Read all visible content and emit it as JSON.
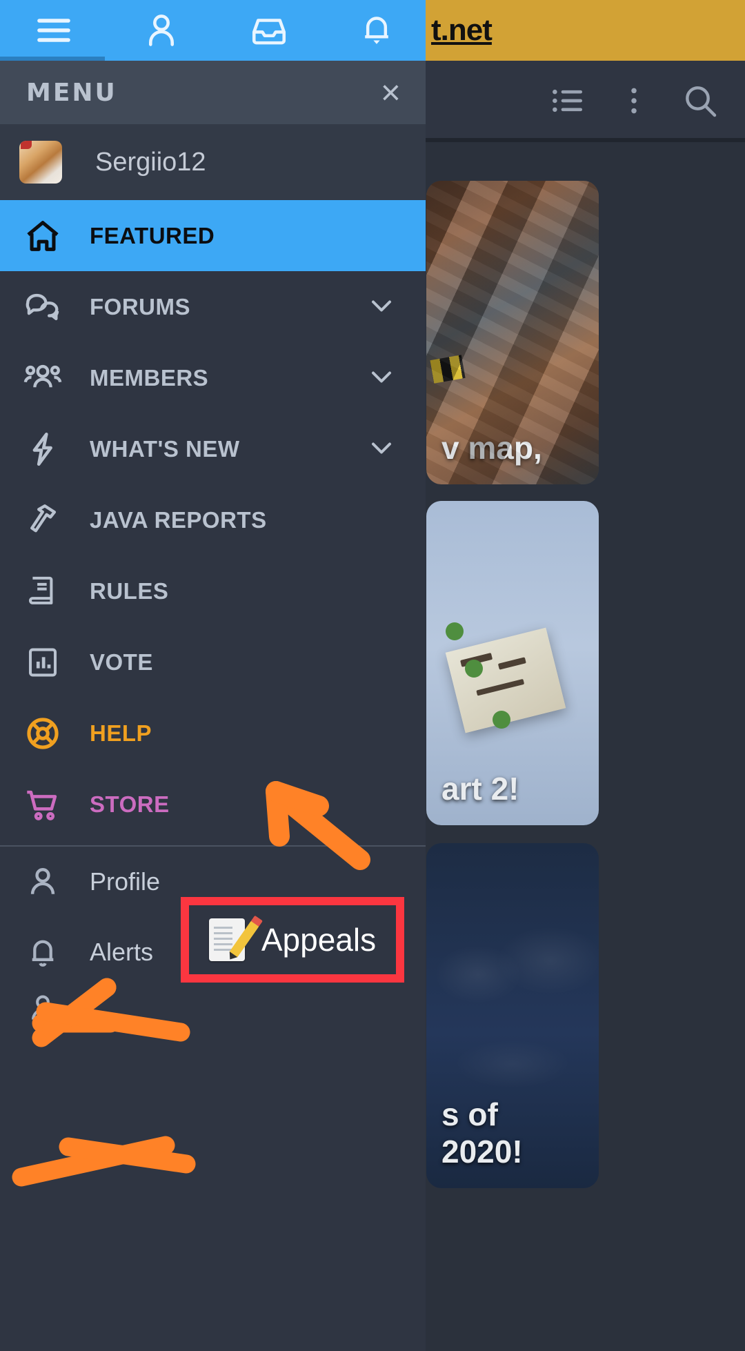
{
  "background": {
    "banner_text": "t.net",
    "toolbar_icons": [
      "list-icon",
      "more-vertical-icon",
      "search-icon"
    ],
    "cards": [
      {
        "caption": "v map,",
        "name": "featured-card-map"
      },
      {
        "caption": "art 2!",
        "name": "featured-card-part2"
      },
      {
        "caption": "s of 2020!",
        "name": "featured-card-2020"
      }
    ]
  },
  "appbar": {
    "icons": [
      "hamburger-menu-icon",
      "user-icon",
      "inbox-icon",
      "bell-icon"
    ]
  },
  "drawer": {
    "title": "MENU",
    "close_label": "×",
    "user": {
      "name": "Sergiio12"
    },
    "items": [
      {
        "label": "FEATURED",
        "icon": "home-icon",
        "active": true,
        "chevron": false,
        "color": ""
      },
      {
        "label": "FORUMS",
        "icon": "chat-bubbles-icon",
        "active": false,
        "chevron": true,
        "color": ""
      },
      {
        "label": "MEMBERS",
        "icon": "people-icon",
        "active": false,
        "chevron": true,
        "color": ""
      },
      {
        "label": "WHAT'S NEW",
        "icon": "lightning-icon",
        "active": false,
        "chevron": true,
        "color": ""
      },
      {
        "label": "JAVA REPORTS",
        "icon": "hammer-icon",
        "active": false,
        "chevron": false,
        "color": ""
      },
      {
        "label": "RULES",
        "icon": "book-icon",
        "active": false,
        "chevron": false,
        "color": ""
      },
      {
        "label": "VOTE",
        "icon": "bar-chart-icon",
        "active": false,
        "chevron": false,
        "color": ""
      },
      {
        "label": "HELP",
        "icon": "lifebuoy-icon",
        "active": false,
        "chevron": false,
        "color": "#f0a020"
      },
      {
        "label": "STORE",
        "icon": "cart-icon",
        "active": false,
        "chevron": false,
        "color": "#cc6cc0"
      }
    ],
    "account_items": [
      {
        "label": "Profile",
        "icon": "person-outline-icon",
        "struck": true
      },
      {
        "label": "Alerts",
        "icon": "bell-outline-icon",
        "struck": true
      }
    ]
  },
  "annotations": {
    "highlight_box": {
      "label": "Appeals",
      "icon": "memo-pencil-icon",
      "border_color": "#fb3640"
    },
    "arrow_color": "#ff8227",
    "strike_color": "#ff8227"
  }
}
